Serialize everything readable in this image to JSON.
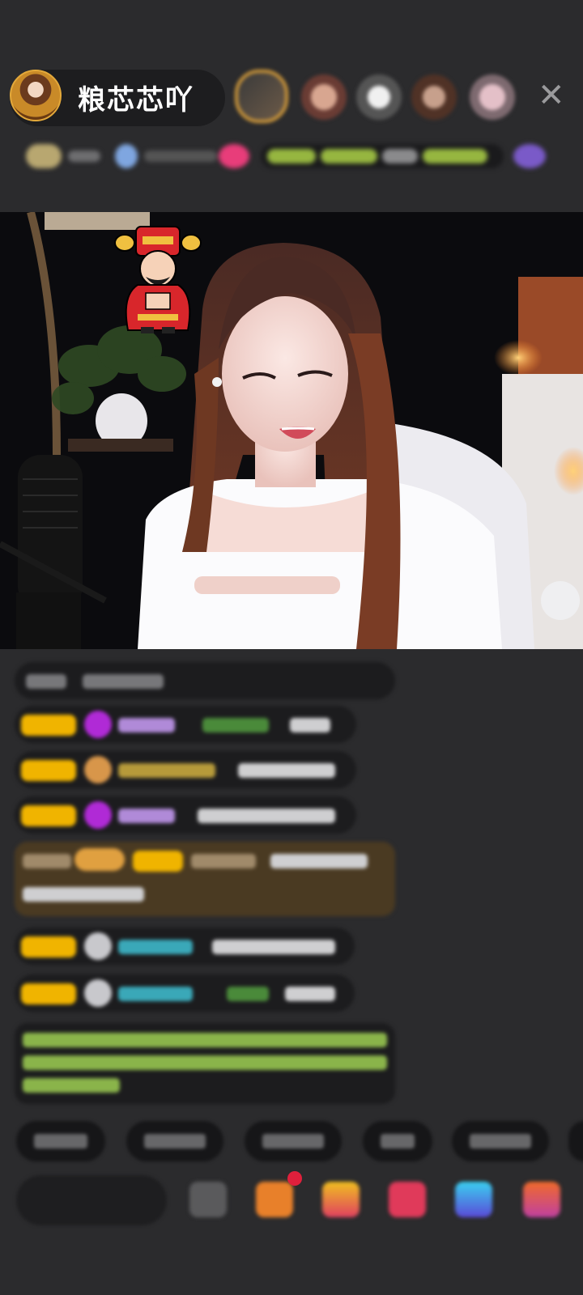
{
  "host": {
    "name": "粮芯芯吖",
    "avatar_icon": "streamer-avatar"
  },
  "viewers": [
    {
      "icon": "viewer-avatar-1"
    },
    {
      "icon": "viewer-avatar-2"
    },
    {
      "icon": "viewer-avatar-3"
    },
    {
      "icon": "viewer-avatar-4"
    },
    {
      "icon": "viewer-avatar-5"
    }
  ],
  "close_icon": "✕",
  "colors": {
    "background": "#2b2b2d",
    "pill": "#1d1d1f",
    "level_badge": "#f0b400",
    "accent_red": "#e0203c"
  },
  "sticker": {
    "icon": "god-of-wealth-sticker"
  }
}
